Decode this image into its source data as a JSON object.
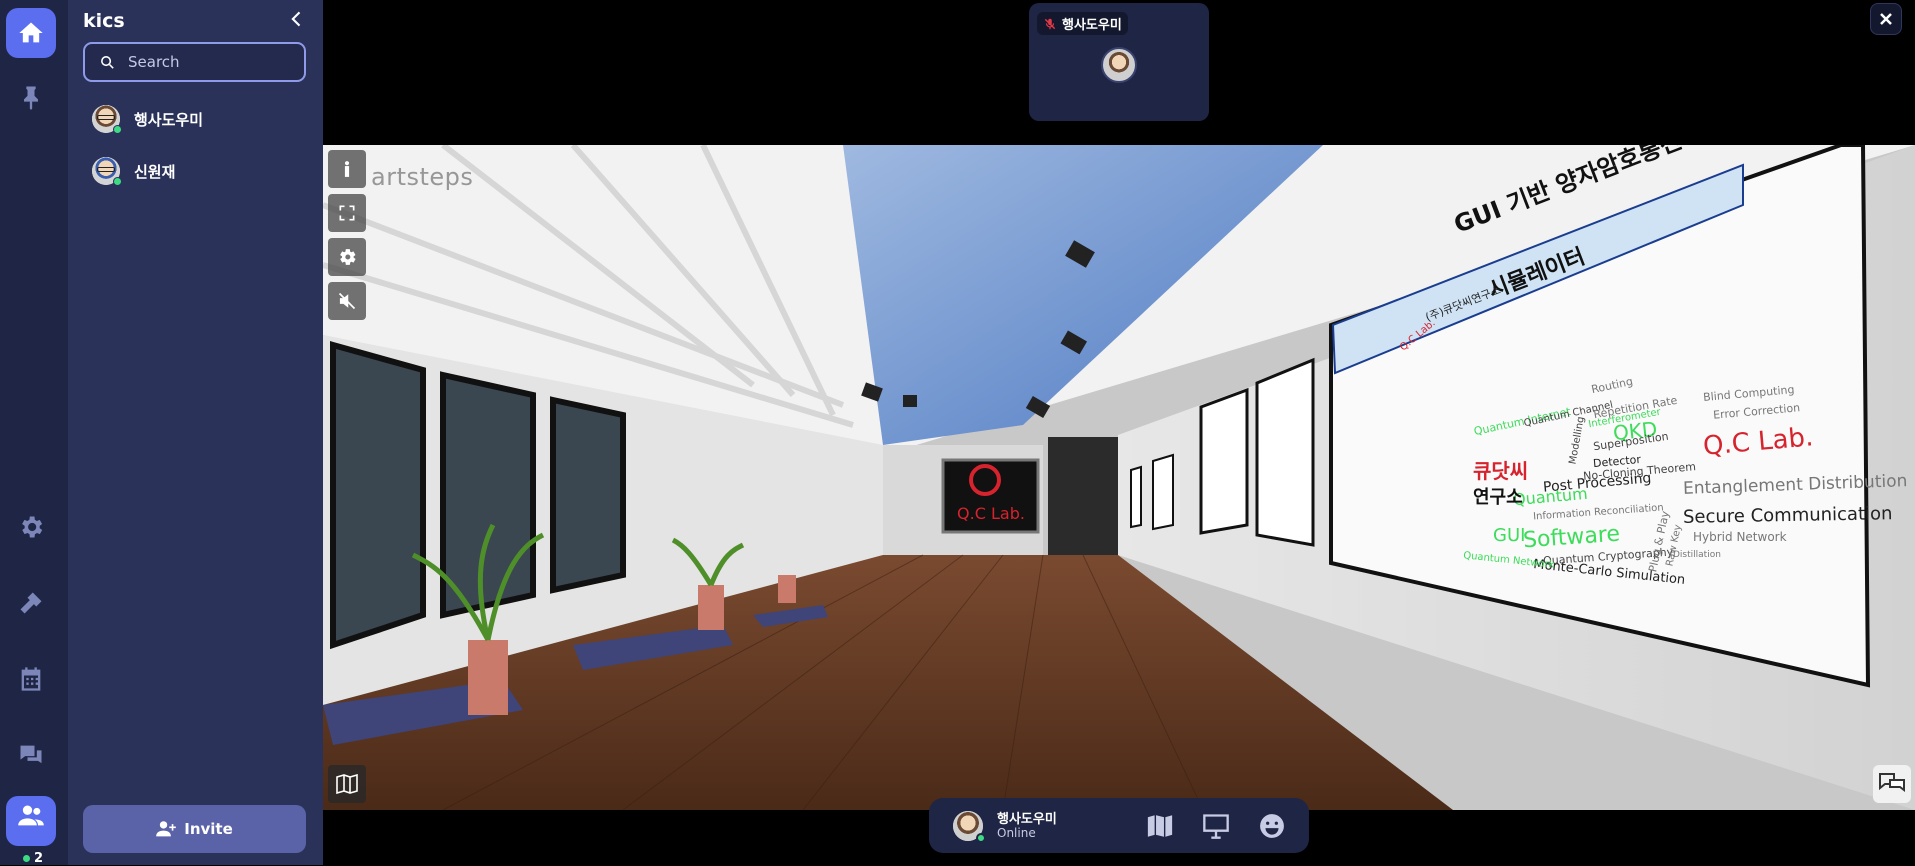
{
  "panel": {
    "title": "kics",
    "search_placeholder": "Search",
    "users": [
      {
        "name": "행사도우미"
      },
      {
        "name": "신원재"
      }
    ],
    "invite_label": "Invite"
  },
  "rail": {
    "people_count": "2"
  },
  "speaker": {
    "name": "행사도우미"
  },
  "scene": {
    "watermark": "artsteps",
    "banner_title": "GUI 기반 양자암호통신",
    "banner_subtitle": "시뮬레이터",
    "banner_org": "(주)큐닷씨연구소",
    "logo_text": "Q.C Lab.",
    "word_cloud": [
      "Q.C Lab.",
      "QKD",
      "Software",
      "Entanglement Distribution",
      "Secure Communication",
      "Post Processing",
      "Quantum",
      "GUI",
      "큐닷씨",
      "연구소",
      "Monte-Carlo Simulation",
      "Hybrid Network",
      "Quantum Cryptography",
      "Detector",
      "Superposition",
      "No-Cloning Theorem",
      "Error Correction",
      "Blind Computing",
      "Repetition Rate",
      "Quantum Internet",
      "Quantum Channel",
      "Routing",
      "Modelling",
      "Information Reconciliation",
      "Plug & Play",
      "Raw Key",
      "Quantum Network",
      "Distillation",
      "Interferometer"
    ]
  },
  "dock": {
    "name": "행사도우미",
    "status": "Online"
  },
  "colors": {
    "rail": "#1f2545",
    "panel": "#2a3259",
    "accent": "#5b6ef0",
    "online": "#3ddc84"
  }
}
